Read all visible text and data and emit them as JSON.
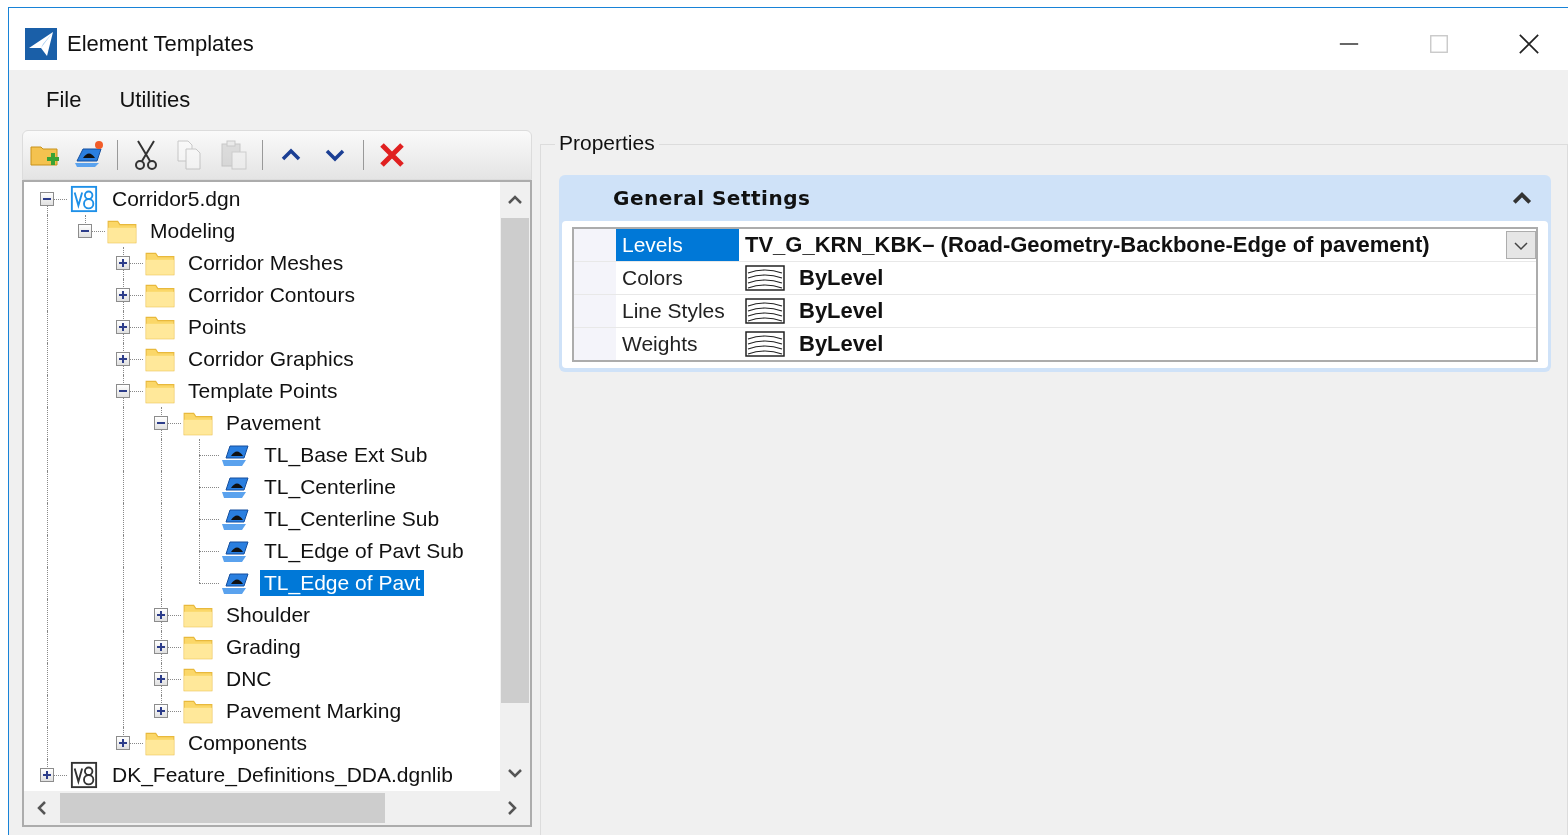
{
  "window": {
    "title": "Element Templates"
  },
  "menu": [
    "File",
    "Utilities"
  ],
  "toolbar": [
    {
      "kind": "new-folder",
      "disabled": false
    },
    {
      "kind": "new-template",
      "disabled": false
    },
    {
      "kind": "separator"
    },
    {
      "kind": "cut",
      "disabled": false
    },
    {
      "kind": "copy",
      "disabled": true
    },
    {
      "kind": "paste",
      "disabled": true
    },
    {
      "kind": "separator"
    },
    {
      "kind": "up",
      "disabled": false
    },
    {
      "kind": "down",
      "disabled": false
    },
    {
      "kind": "separator"
    },
    {
      "kind": "delete",
      "disabled": false
    }
  ],
  "tree": [
    {
      "label": "Corridor5.dgn",
      "kind": "file",
      "expanded": true,
      "selected": false,
      "children": [
        {
          "label": "Modeling",
          "kind": "folder",
          "expanded": true,
          "selected": false,
          "children": [
            {
              "label": "Corridor Meshes",
              "kind": "folder",
              "expanded": false,
              "selected": false
            },
            {
              "label": "Corridor Contours",
              "kind": "folder",
              "expanded": false,
              "selected": false
            },
            {
              "label": "Points",
              "kind": "folder",
              "expanded": false,
              "selected": false
            },
            {
              "label": "Corridor Graphics",
              "kind": "folder",
              "expanded": false,
              "selected": false
            },
            {
              "label": "Template Points",
              "kind": "folder",
              "expanded": true,
              "selected": false,
              "children": [
                {
                  "label": "Pavement",
                  "kind": "folder",
                  "expanded": true,
                  "selected": false,
                  "children": [
                    {
                      "label": "TL_Base Ext Sub",
                      "kind": "template",
                      "selected": false
                    },
                    {
                      "label": "TL_Centerline",
                      "kind": "template",
                      "selected": false
                    },
                    {
                      "label": "TL_Centerline Sub",
                      "kind": "template",
                      "selected": false
                    },
                    {
                      "label": "TL_Edge of Pavt Sub",
                      "kind": "template",
                      "selected": false
                    },
                    {
                      "label": "TL_Edge of Pavt",
                      "kind": "template",
                      "selected": true
                    }
                  ]
                },
                {
                  "label": "Shoulder",
                  "kind": "folder",
                  "expanded": false,
                  "selected": false
                },
                {
                  "label": "Grading",
                  "kind": "folder",
                  "expanded": false,
                  "selected": false
                },
                {
                  "label": "DNC",
                  "kind": "folder",
                  "expanded": false,
                  "selected": false
                },
                {
                  "label": "Pavement Marking",
                  "kind": "folder",
                  "expanded": false,
                  "selected": false
                }
              ]
            },
            {
              "label": "Components",
              "kind": "folder",
              "expanded": false,
              "selected": false
            }
          ]
        }
      ]
    },
    {
      "label": "DK_Feature_Definitions_DDA.dgnlib",
      "kind": "library",
      "expanded": false,
      "selected": false
    }
  ],
  "properties": {
    "title": "Properties",
    "section": {
      "title": "General Settings",
      "expanded": true,
      "rows": [
        {
          "label": "Levels",
          "value": "TV_G_KRN_KBK– (Road-Geometry-Backbone-Edge of pavement)",
          "kind": "dropdown",
          "selected": true
        },
        {
          "label": "Colors",
          "value": "ByLevel",
          "kind": "swatch",
          "selected": false
        },
        {
          "label": "Line Styles",
          "value": "ByLevel",
          "kind": "swatch",
          "selected": false
        },
        {
          "label": "Weights",
          "value": "ByLevel",
          "kind": "swatch",
          "selected": false
        }
      ]
    }
  }
}
